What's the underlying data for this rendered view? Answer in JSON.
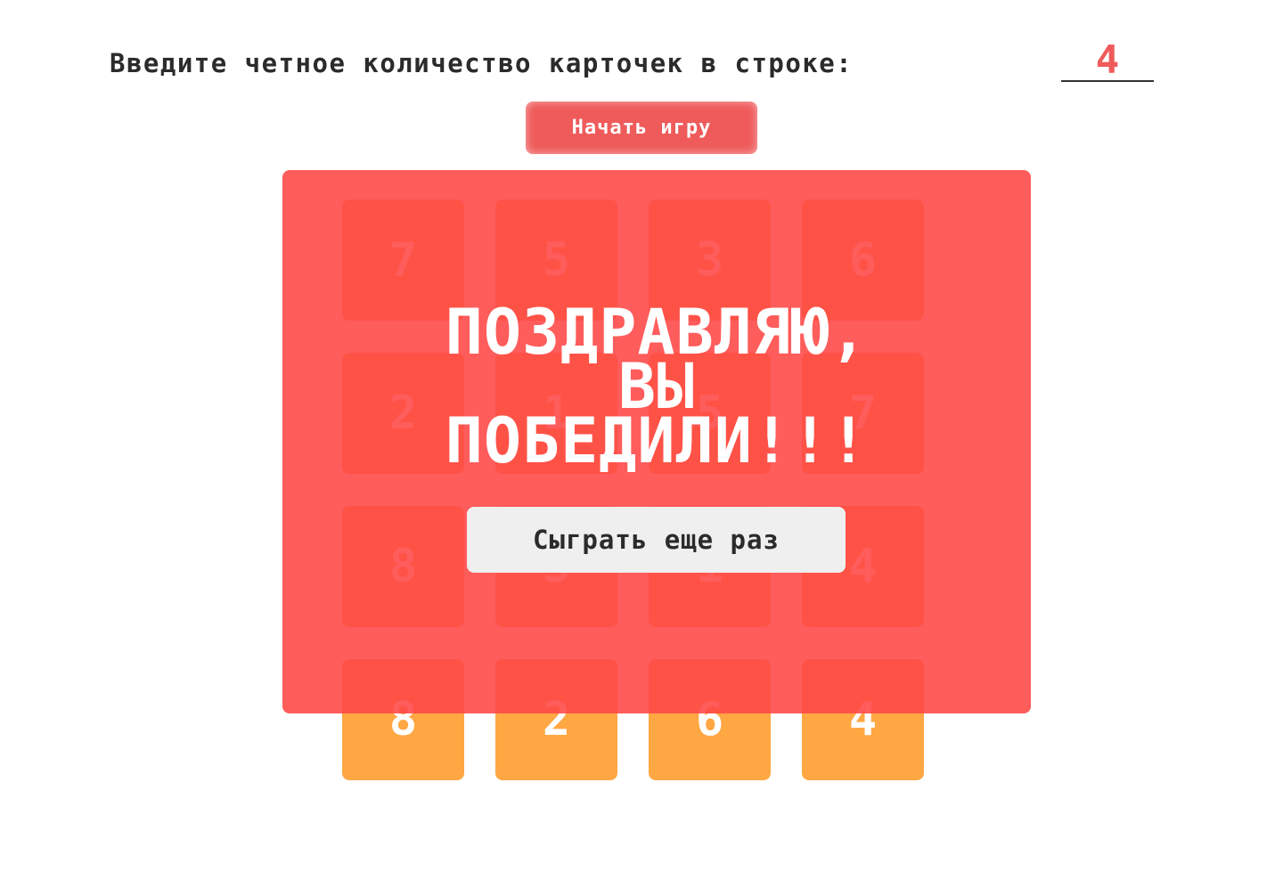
{
  "settings": {
    "prompt_label": "Введите четное количество карточек в строке:",
    "cards_per_row_value": "4",
    "start_button_label": "Начать игру"
  },
  "board": {
    "cards_per_row": 4,
    "cards": [
      "7",
      "5",
      "3",
      "6",
      "2",
      "1",
      "5",
      "7",
      "8",
      "3",
      "1",
      "4",
      "8",
      "2",
      "6",
      "4"
    ]
  },
  "win_overlay": {
    "title_line1": "ПОЗДРАВЛЯЮ,",
    "title_line2": "ВЫ",
    "title_line3": "ПОБЕДИЛИ!!!",
    "play_again_label": "Сыграть еще раз"
  },
  "colors": {
    "accent_red": "#ef5b5b",
    "card_orange": "#ffa743",
    "overlay_red": "#ff4848",
    "button_gray": "#efefef",
    "text_dark": "#2b2b2b"
  }
}
